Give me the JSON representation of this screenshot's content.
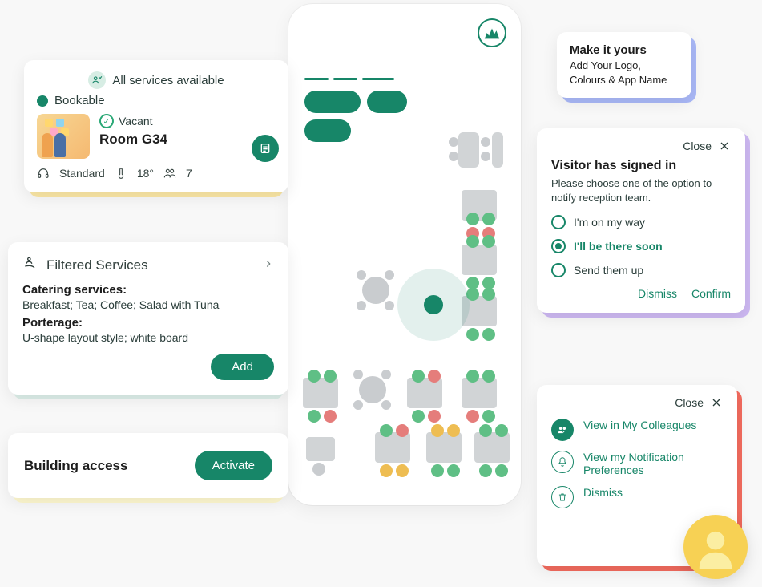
{
  "phone": {
    "logo_name": "skyline-logo"
  },
  "room_card": {
    "services_available": "All services available",
    "bookable": "Bookable",
    "vacant": "Vacant",
    "room_name": "Room G34",
    "standard": "Standard",
    "temperature": "18°",
    "capacity": "7"
  },
  "filtered": {
    "title": "Filtered Services",
    "catering_label": "Catering services:",
    "catering_text": "Breakfast; Tea; Coffee; Salad with Tuna",
    "porterage_label": "Porterage:",
    "porterage_text": "U-shape layout style; white board",
    "add_label": "Add"
  },
  "access": {
    "title": "Building access",
    "activate_label": "Activate"
  },
  "brand": {
    "title": "Make it yours",
    "line1": "Add Your Logo,",
    "line2": "Colours & App Name"
  },
  "visitor": {
    "close_label": "Close",
    "title": "Visitor has signed in",
    "subtitle": "Please choose one of the option to notify reception team.",
    "opt1": "I'm on my way",
    "opt2": "I'll be there soon",
    "opt3": "Send them up",
    "dismiss": "Dismiss",
    "confirm": "Confirm"
  },
  "options": {
    "close_label": "Close",
    "row1": "View in My Colleagues",
    "row2": "View my Notification Preferences",
    "row3": "Dismiss"
  }
}
